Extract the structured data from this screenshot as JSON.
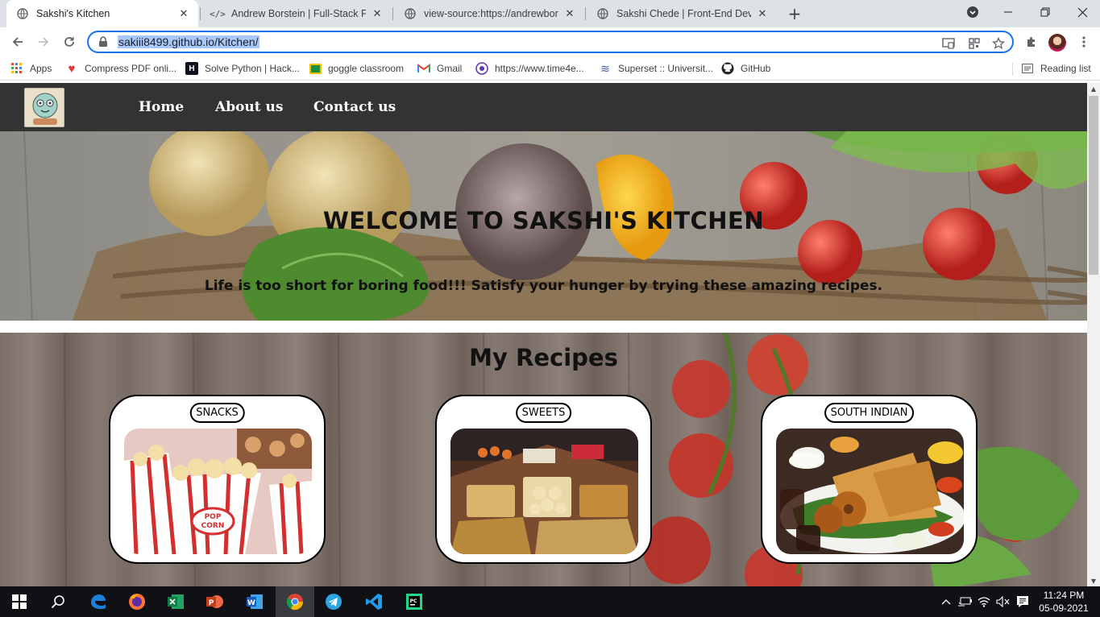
{
  "browser": {
    "tabs": [
      {
        "title": "Sakshi's Kitchen",
        "icon": "globe-icon",
        "active": true
      },
      {
        "title": "Andrew Borstein | Full-Stack Fron",
        "icon": "code-icon",
        "active": false
      },
      {
        "title": "view-source:https://andrewborste",
        "icon": "globe-icon",
        "active": false
      },
      {
        "title": "Sakshi Chede | Front-End Develop",
        "icon": "globe-icon",
        "active": false
      }
    ],
    "url": "sakiii8499.github.io/Kitchen/",
    "bookmarks": [
      {
        "label": "Apps",
        "icon": "apps-grid-icon"
      },
      {
        "label": "Compress PDF onli...",
        "icon": "heart-icon"
      },
      {
        "label": "Solve Python | Hack...",
        "icon": "hackerrank-icon"
      },
      {
        "label": "goggle classroom",
        "icon": "classroom-icon"
      },
      {
        "label": "Gmail",
        "icon": "gmail-icon"
      },
      {
        "label": "https://www.time4e...",
        "icon": "site-icon"
      },
      {
        "label": "Superset :: Universit...",
        "icon": "superset-icon"
      },
      {
        "label": "GitHub",
        "icon": "github-icon"
      }
    ],
    "reading_list": "Reading list"
  },
  "site": {
    "nav": {
      "logo": "Spoon",
      "links": [
        "Home",
        "About us",
        "Contact us"
      ]
    },
    "hero": {
      "title": "WELCOME TO SAKSHI'S KITCHEN",
      "subtitle": "Life is too short for boring food!!! Satisfy your hunger by trying these amazing recipes."
    },
    "recipes": {
      "title": "My Recipes",
      "cards": [
        {
          "label": "SNACKS",
          "image": "popcorn"
        },
        {
          "label": "SWEETS",
          "image": "indian-sweets"
        },
        {
          "label": "SOUTH INDIAN",
          "image": "dosa-vada"
        }
      ]
    }
  },
  "taskbar": {
    "apps": [
      "windows-start-icon",
      "search-icon",
      "edge-icon",
      "firefox-icon",
      "excel-icon",
      "powerpoint-icon",
      "word-icon",
      "chrome-icon",
      "telegram-icon",
      "vscode-icon",
      "pycharm-icon"
    ],
    "time": "11:24 PM",
    "date": "05-09-2021"
  },
  "colors": {
    "nav_bg": "#333333",
    "accent_blue": "#1a73e8"
  }
}
